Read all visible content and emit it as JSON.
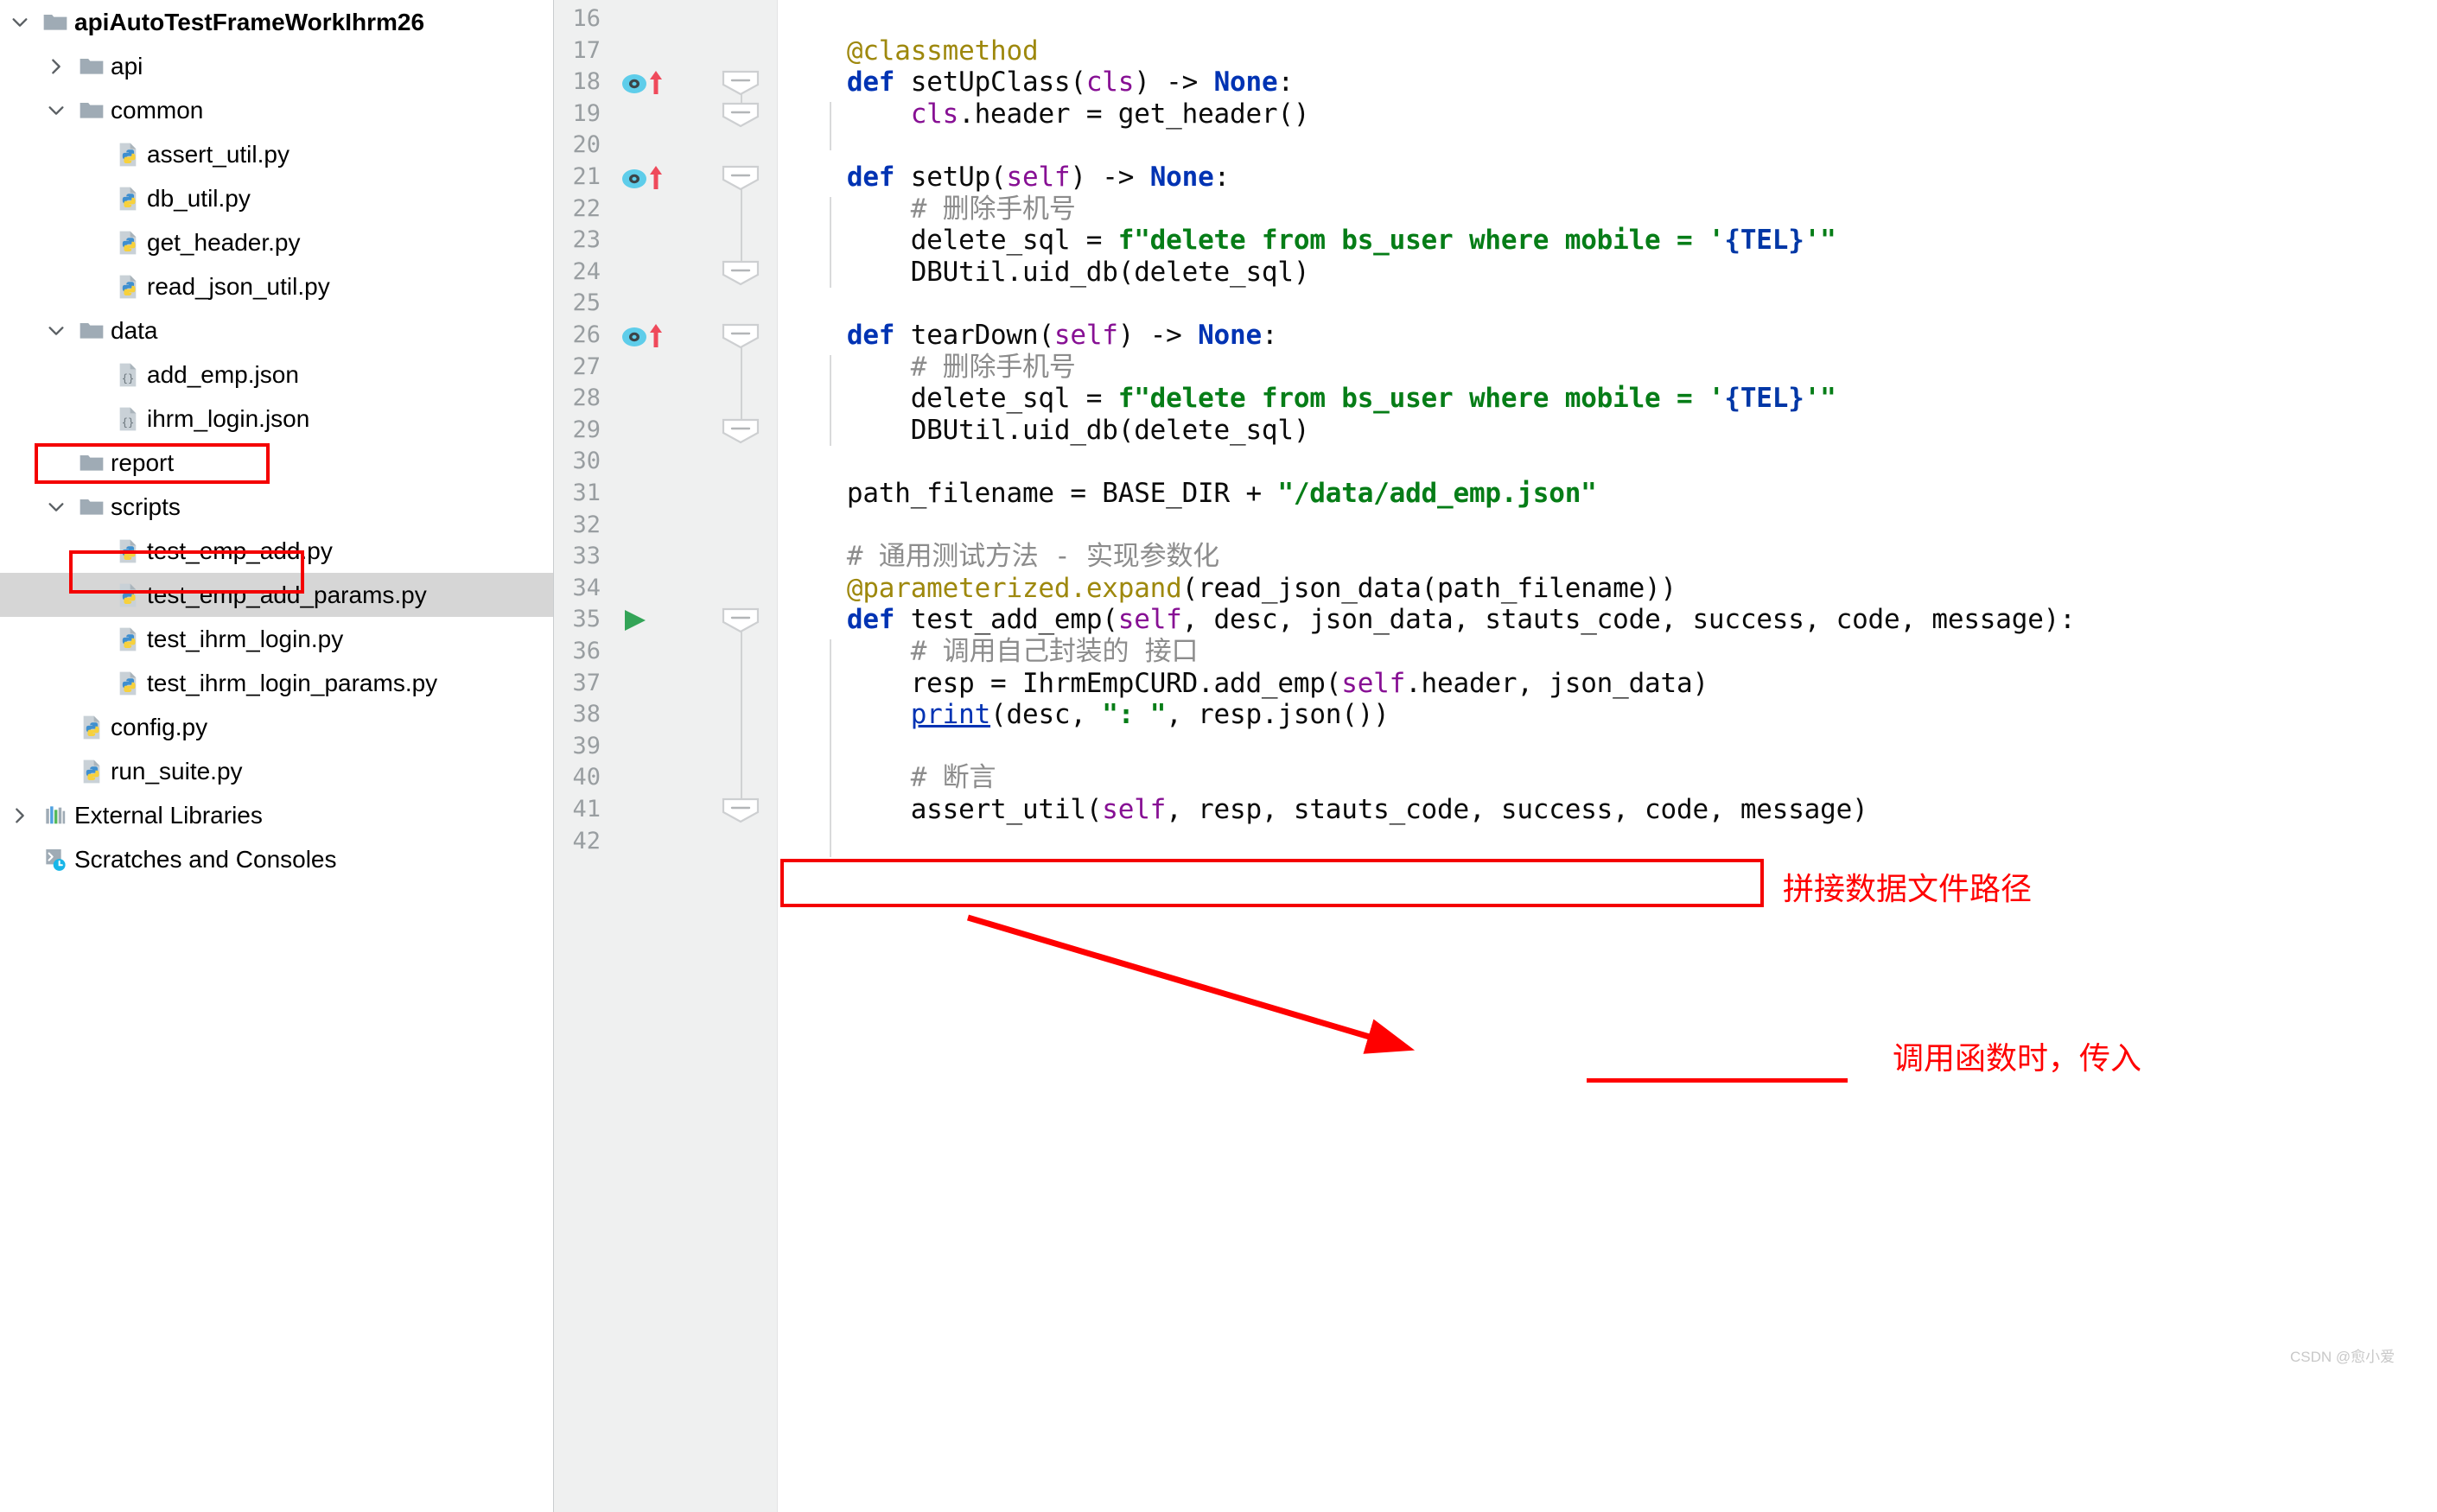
{
  "app": "PyCharm",
  "project_tree": {
    "items": [
      {
        "label": "apiAutoTestFrameWorkIhrm26",
        "icon": "folder-icon",
        "depth": 0,
        "twisty": "expanded",
        "bold": true,
        "type": "folder"
      },
      {
        "label": "api",
        "icon": "folder-icon",
        "depth": 1,
        "twisty": "collapsed",
        "bold": false,
        "type": "folder"
      },
      {
        "label": "common",
        "icon": "folder-icon",
        "depth": 1,
        "twisty": "expanded",
        "bold": false,
        "type": "folder"
      },
      {
        "label": "assert_util.py",
        "icon": "python-file-icon",
        "depth": 2,
        "twisty": "none",
        "bold": false,
        "type": "python"
      },
      {
        "label": "db_util.py",
        "icon": "python-file-icon",
        "depth": 2,
        "twisty": "none",
        "bold": false,
        "type": "python"
      },
      {
        "label": "get_header.py",
        "icon": "python-file-icon",
        "depth": 2,
        "twisty": "none",
        "bold": false,
        "type": "python"
      },
      {
        "label": "read_json_util.py",
        "icon": "python-file-icon",
        "depth": 2,
        "twisty": "none",
        "bold": false,
        "type": "python"
      },
      {
        "label": "data",
        "icon": "folder-icon",
        "depth": 1,
        "twisty": "expanded",
        "bold": false,
        "type": "folder"
      },
      {
        "label": "add_emp.json",
        "icon": "json-file-icon",
        "depth": 2,
        "twisty": "none",
        "bold": false,
        "type": "json"
      },
      {
        "label": "ihrm_login.json",
        "icon": "json-file-icon",
        "depth": 2,
        "twisty": "none",
        "bold": false,
        "type": "json"
      },
      {
        "label": "report",
        "icon": "folder-icon",
        "depth": 1,
        "twisty": "none",
        "bold": false,
        "type": "folder"
      },
      {
        "label": "scripts",
        "icon": "folder-icon",
        "depth": 1,
        "twisty": "expanded",
        "bold": false,
        "type": "folder",
        "highlighted": true
      },
      {
        "label": "test_emp_add.py",
        "icon": "python-file-icon",
        "depth": 2,
        "twisty": "none",
        "bold": false,
        "type": "python"
      },
      {
        "label": "test_emp_add_params.py",
        "icon": "python-file-icon",
        "depth": 2,
        "twisty": "none",
        "bold": false,
        "type": "python",
        "selected": true,
        "highlighted": true
      },
      {
        "label": "test_ihrm_login.py",
        "icon": "python-file-icon",
        "depth": 2,
        "twisty": "none",
        "bold": false,
        "type": "python"
      },
      {
        "label": "test_ihrm_login_params.py",
        "icon": "python-file-icon",
        "depth": 2,
        "twisty": "none",
        "bold": false,
        "type": "python"
      },
      {
        "label": "config.py",
        "icon": "python-file-icon",
        "depth": 1,
        "twisty": "none",
        "bold": false,
        "type": "python"
      },
      {
        "label": "run_suite.py",
        "icon": "python-file-icon",
        "depth": 1,
        "twisty": "none",
        "bold": false,
        "type": "python"
      },
      {
        "label": "External Libraries",
        "icon": "library-icon",
        "depth": 0,
        "twisty": "collapsed",
        "bold": false,
        "type": "library"
      },
      {
        "label": "Scratches and Consoles",
        "icon": "scratches-icon",
        "depth": 0,
        "twisty": "none",
        "bold": false,
        "type": "scratches"
      }
    ]
  },
  "editor": {
    "first_line": 16,
    "gutter_markers": [
      {
        "line": 18,
        "marker": "override-method-icon"
      },
      {
        "line": 21,
        "marker": "override-method-icon"
      },
      {
        "line": 26,
        "marker": "override-method-icon"
      },
      {
        "line": 35,
        "marker": "run-test-icon"
      }
    ],
    "fold_markers": [
      18,
      19,
      21,
      24,
      26,
      29,
      35,
      41
    ],
    "lines": [
      {
        "n": 16,
        "text": ""
      },
      {
        "n": 17,
        "text": "    @classmethod"
      },
      {
        "n": 18,
        "text": "    def setUpClass(cls) -> None:"
      },
      {
        "n": 19,
        "text": "        cls.header = get_header()"
      },
      {
        "n": 20,
        "text": ""
      },
      {
        "n": 21,
        "text": "    def setUp(self) -> None:"
      },
      {
        "n": 22,
        "text": "        # 删除手机号"
      },
      {
        "n": 23,
        "text": "        delete_sql = f\"delete from bs_user where mobile = '{TEL}'\""
      },
      {
        "n": 24,
        "text": "        DBUtil.uid_db(delete_sql)"
      },
      {
        "n": 25,
        "text": ""
      },
      {
        "n": 26,
        "text": "    def tearDown(self) -> None:"
      },
      {
        "n": 27,
        "text": "        # 删除手机号"
      },
      {
        "n": 28,
        "text": "        delete_sql = f\"delete from bs_user where mobile = '{TEL}'\""
      },
      {
        "n": 29,
        "text": "        DBUtil.uid_db(delete_sql)"
      },
      {
        "n": 30,
        "text": ""
      },
      {
        "n": 31,
        "text": "    path_filename = BASE_DIR + \"/data/add_emp.json\""
      },
      {
        "n": 32,
        "text": ""
      },
      {
        "n": 33,
        "text": "    # 通用测试方法 - 实现参数化"
      },
      {
        "n": 34,
        "text": "    @parameterized.expand(read_json_data(path_filename))"
      },
      {
        "n": 35,
        "text": "    def test_add_emp(self, desc, json_data, stauts_code, success, code, message):"
      },
      {
        "n": 36,
        "text": "        # 调用自己封装的 接口"
      },
      {
        "n": 37,
        "text": "        resp = IhrmEmpCURD.add_emp(self.header, json_data)"
      },
      {
        "n": 38,
        "text": "        print(desc, \": \", resp.json())"
      },
      {
        "n": 39,
        "text": ""
      },
      {
        "n": 40,
        "text": "        # 断言"
      },
      {
        "n": 41,
        "text": "        assert_util(self, resp, stauts_code, success, code, message)"
      },
      {
        "n": 42,
        "text": ""
      }
    ]
  },
  "annotations": {
    "label_path": "拼接数据文件路径",
    "label_call": "调用函数时，传入",
    "color": "#ff0000"
  },
  "watermark": "CSDN @愈小爱"
}
